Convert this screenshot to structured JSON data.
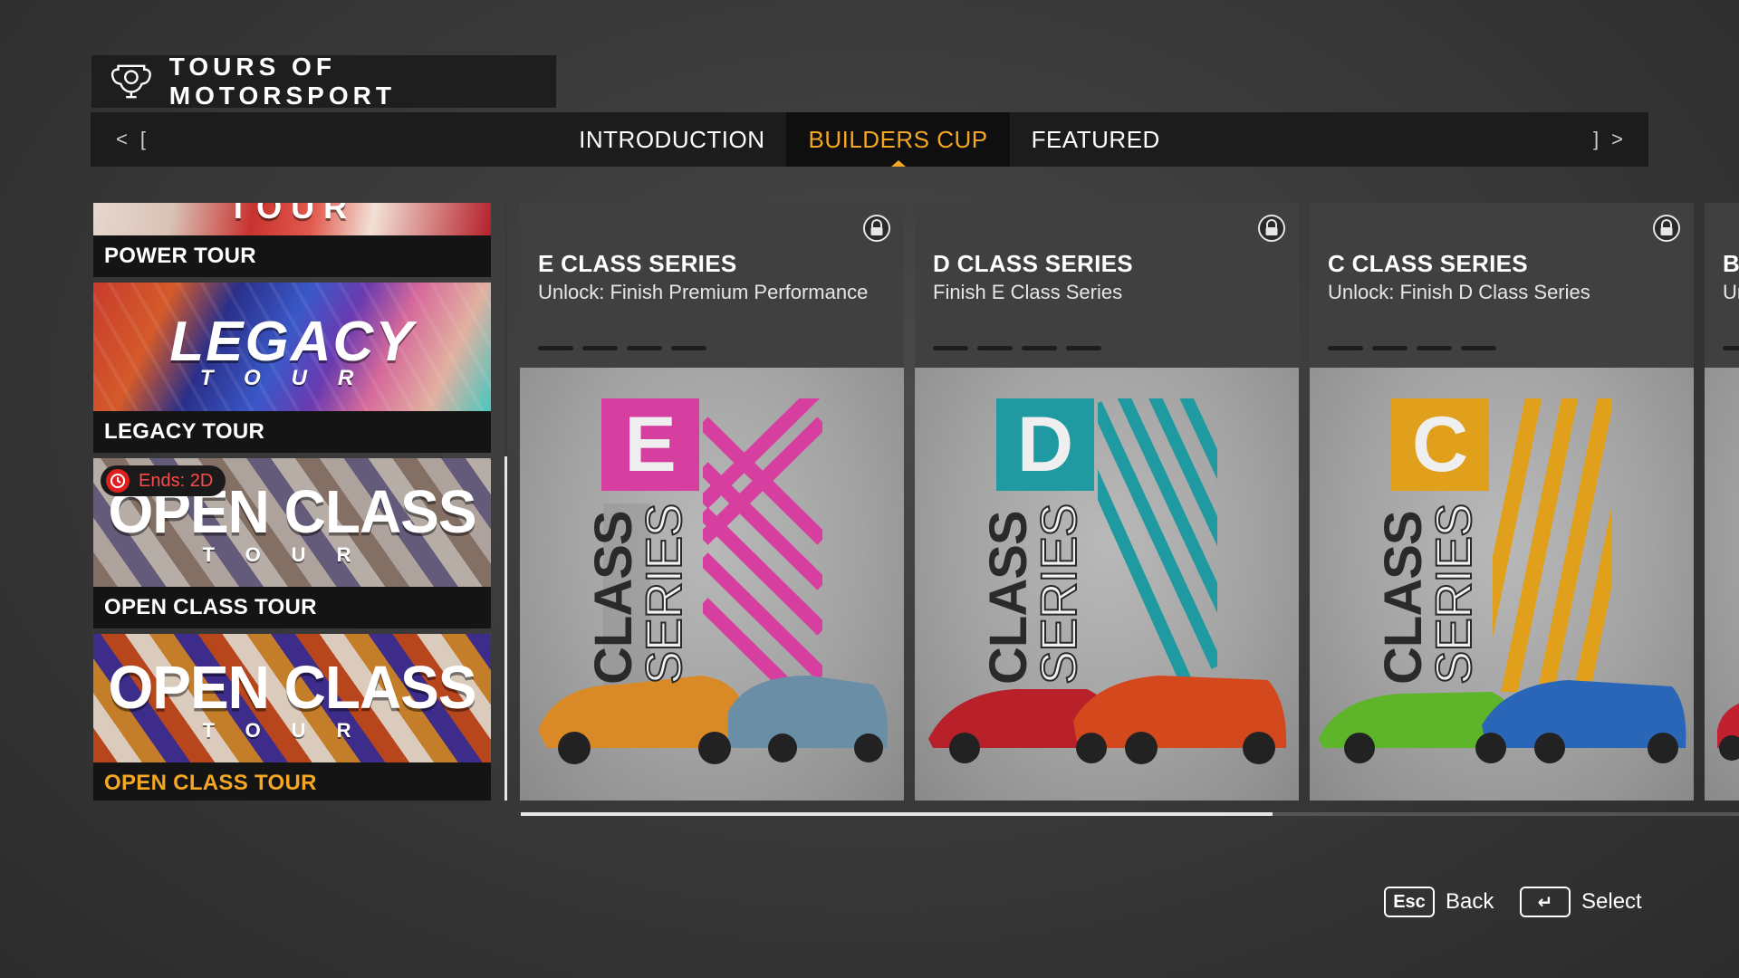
{
  "header": {
    "title": "TOURS OF MOTORSPORT",
    "icon": "trophy-icon"
  },
  "tabs": {
    "left_nav": [
      "<",
      "["
    ],
    "right_nav": [
      "]",
      ">"
    ],
    "items": [
      {
        "label": "INTRODUCTION",
        "active": false
      },
      {
        "label": "BUILDERS CUP",
        "active": true
      },
      {
        "label": "FEATURED",
        "active": false
      }
    ]
  },
  "tours": [
    {
      "label": "POWER TOUR",
      "art_word": "TOUR"
    },
    {
      "label": "LEGACY TOUR",
      "art_word": "LEGACY",
      "art_sub": "TOUR"
    },
    {
      "label": "OPEN CLASS TOUR",
      "art_word": "OPEN CLASS",
      "art_sub": "TOUR",
      "badge": "Ends: 2D"
    },
    {
      "label": "OPEN CLASS TOUR",
      "art_word": "OPEN CLASS",
      "art_sub": "TOUR",
      "selected": true
    }
  ],
  "cards": [
    {
      "name": "E CLASS SERIES",
      "subtitle": "Unlock: Finish Premium Performance",
      "letter": "E",
      "poster_words": [
        "CLASS",
        "SERIES"
      ],
      "accent": "#d63fa0",
      "locked": true
    },
    {
      "name": "D CLASS SERIES",
      "subtitle": "Finish E Class Series",
      "letter": "D",
      "poster_words": [
        "CLASS",
        "SERIES"
      ],
      "accent": "#1f9aa0",
      "locked": true
    },
    {
      "name": "C CLASS SERIES",
      "subtitle": "Unlock: Finish D Class Series",
      "letter": "C",
      "poster_words": [
        "CLASS",
        "SERIES"
      ],
      "accent": "#e0a01c",
      "locked": true
    },
    {
      "name": "B",
      "subtitle": "Ur",
      "letter": "",
      "accent": "#c02030",
      "locked": false
    }
  ],
  "footer": {
    "back": {
      "key": "Esc",
      "label": "Back"
    },
    "select": {
      "key": "↵",
      "label": "Select"
    }
  },
  "colors": {
    "accent": "#f5a623",
    "panel": "#1c1c1c"
  }
}
